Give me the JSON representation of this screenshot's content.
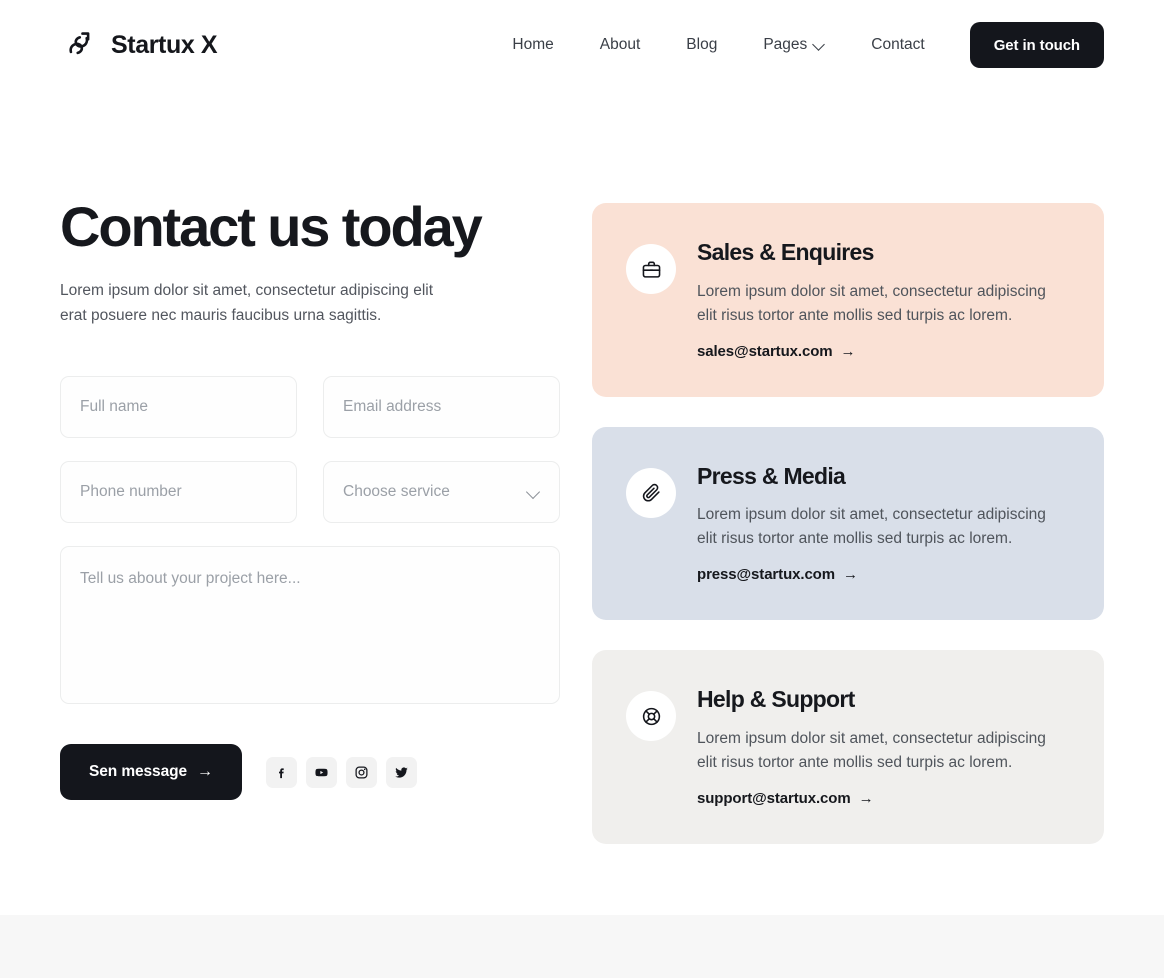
{
  "header": {
    "brand_name": "Startux X",
    "logo_icon": "startux-swirl-arrow-logo",
    "nav": [
      {
        "label": "Home",
        "has_chevron": false
      },
      {
        "label": "About",
        "has_chevron": false
      },
      {
        "label": "Blog",
        "has_chevron": false
      },
      {
        "label": "Pages",
        "has_chevron": true
      },
      {
        "label": "Contact",
        "has_chevron": false
      }
    ],
    "cta_label": "Get in touch"
  },
  "hero": {
    "title": "Contact us today",
    "subtitle": "Lorem ipsum dolor sit amet, consectetur adipiscing elit erat posuere nec mauris faucibus urna sagittis."
  },
  "form": {
    "full_name": {
      "placeholder": "Full name",
      "value": ""
    },
    "email": {
      "placeholder": "Email address",
      "value": ""
    },
    "phone": {
      "placeholder": "Phone number",
      "value": ""
    },
    "service": {
      "placeholder": "Choose service",
      "value": "",
      "chevron_icon": "chevron-down-icon"
    },
    "message": {
      "placeholder": "Tell us about your project here...",
      "value": ""
    },
    "submit_label": "Sen message",
    "submit_arrow": "→"
  },
  "socials": [
    {
      "name": "facebook",
      "glyph": "f"
    },
    {
      "name": "youtube",
      "glyph": ""
    },
    {
      "name": "instagram",
      "glyph": ""
    },
    {
      "name": "twitter",
      "glyph": ""
    }
  ],
  "cards": [
    {
      "title": "Sales & Enquires",
      "desc": "Lorem ipsum dolor sit amet, consectetur adipiscing elit risus tortor ante mollis sed turpis ac lorem.",
      "email": "sales@startux.com",
      "arrow": "→",
      "icon": "briefcase-icon",
      "bg": "#FAE1D5"
    },
    {
      "title": "Press & Media",
      "desc": "Lorem ipsum dolor sit amet, consectetur adipiscing elit risus tortor ante mollis sed turpis ac lorem.",
      "email": "press@startux.com",
      "arrow": "→",
      "icon": "paperclip-icon",
      "bg": "#D9DFE9"
    },
    {
      "title": "Help & Support",
      "desc": "Lorem ipsum dolor sit amet, consectetur adipiscing elit risus tortor ante mollis sed turpis ac lorem.",
      "email": "support@startux.com",
      "arrow": "→",
      "icon": "lifebuoy-icon",
      "bg": "#F0EFED"
    }
  ],
  "colors": {
    "ink": "#14161C",
    "body_text": "#52565E",
    "placeholder": "#9BA0A7",
    "field_border": "#ECEDED",
    "social_bg": "#F2F2F2",
    "footer_strip": "#F7F7F7",
    "page_bg": "#FFFFFF"
  }
}
